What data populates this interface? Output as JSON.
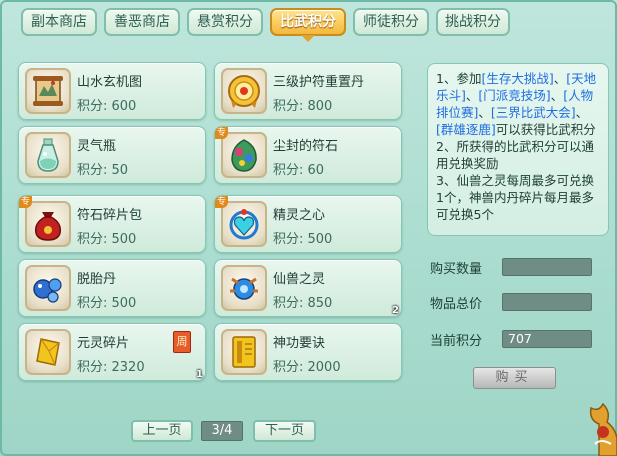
{
  "tabs": [
    {
      "label": "副本商店",
      "active": false
    },
    {
      "label": "善恶商店",
      "active": false
    },
    {
      "label": "悬赏积分",
      "active": false
    },
    {
      "label": "比武积分",
      "active": true
    },
    {
      "label": "师徒积分",
      "active": false
    },
    {
      "label": "挑战积分",
      "active": false
    }
  ],
  "items": [
    {
      "name": "山水玄机图",
      "price": "积分: 600",
      "icon": "scroll-map-icon"
    },
    {
      "name": "三级护符重置丹",
      "price": "积分: 800",
      "icon": "golden-pill-icon"
    },
    {
      "name": "灵气瓶",
      "price": "积分: 50",
      "icon": "spirit-bottle-icon"
    },
    {
      "name": "尘封的符石",
      "price": "积分: 60",
      "icon": "runestone-icon",
      "special": "专"
    },
    {
      "name": "符石碎片包",
      "price": "积分: 500",
      "icon": "red-pouch-icon",
      "special": "专"
    },
    {
      "name": "精灵之心",
      "price": "积分: 500",
      "icon": "elf-heart-icon",
      "special": "专"
    },
    {
      "name": "脱胎丹",
      "price": "积分: 500",
      "icon": "blue-pill-icon"
    },
    {
      "name": "仙兽之灵",
      "price": "积分: 850",
      "icon": "beast-spirit-icon",
      "qty": "2"
    },
    {
      "name": "元灵碎片",
      "price": "积分: 2320",
      "icon": "yellow-shard-icon",
      "qty": "1",
      "tag": "周"
    },
    {
      "name": "神功要诀",
      "price": "积分: 2000",
      "icon": "manual-book-icon"
    }
  ],
  "info": {
    "l1a": "1、参加",
    "l1b": "[生存大挑战]",
    "l1c": "、",
    "l1d": "[天地乐斗]",
    "l1e": "、",
    "l1f": "[门派竞技场]",
    "l1g": "、",
    "l1h": "[人物排位赛]",
    "l1i": "、",
    "l1j": "[三界比武大会]",
    "l1k": "、",
    "l1l": "[群雄逐鹿]",
    "l1m": "可以获得比武积分",
    "l2": "2、所获得的比武积分可以通用兑换奖励",
    "l3": "3、仙兽之灵每周最多可兑换1个，神兽内丹碎片每月最多可兑换5个"
  },
  "form": {
    "qty_label": "购买数量",
    "qty_value": "",
    "total_label": "物品总价",
    "total_value": "",
    "points_label": "当前积分",
    "points_value": "707",
    "buy_label": "购买"
  },
  "pager": {
    "prev": "上一页",
    "page": "3/4",
    "next": "下一页"
  }
}
